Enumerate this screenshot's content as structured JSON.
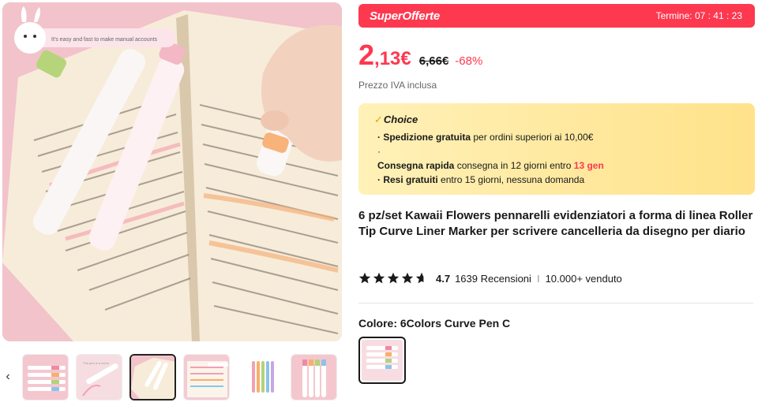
{
  "gallery": {
    "main_image_alt": "Highlighters on open book",
    "banner_text": "It's easy and fast to make manual accounts",
    "thumb_prev_icon": "chevron-left-icon",
    "thumbnails": [
      {
        "label": "thumb-1"
      },
      {
        "label": "thumb-2"
      },
      {
        "label": "thumb-3"
      },
      {
        "label": "thumb-4"
      },
      {
        "label": "thumb-5"
      },
      {
        "label": "thumb-6"
      }
    ],
    "active_thumb": 3
  },
  "deal": {
    "brand": "SuperOfferte",
    "timer_label": "Termine: 07 : 41 : 23"
  },
  "price": {
    "integer": "2",
    "decimal": ",13€",
    "old": "6,66€",
    "discount": "-68%",
    "vat_note": "Prezzo IVA inclusa"
  },
  "choice": {
    "title": "Choice",
    "shipping_bold": "· Spedizione gratuita",
    "shipping_text": " per ordini superiori ai 10,00€",
    "bullet": "·",
    "fast_bold": "Consegna rapida",
    "fast_text": " consegna in 12 giorni entro ",
    "fast_date": "13 gen",
    "returns_bold": "· Resi gratuiti",
    "returns_text": "  entro 15 giorni, nessuna domanda"
  },
  "product": {
    "title": "6 pz/set Kawaii Flowers pennarelli evidenziatori a forma di linea Roller Tip Curve Liner Marker per scrivere cancelleria da disegno per diario",
    "rating": "4.7",
    "rating_value": 4.7,
    "reviews": "1639 Recensioni",
    "separator": "I",
    "sold": "10.000+ venduto"
  },
  "variant": {
    "label": "Colore: 6Colors Curve Pen C"
  },
  "colors": {
    "accent": "#fd384f",
    "choice_bg": "#ffe28a",
    "star": "#191919"
  }
}
